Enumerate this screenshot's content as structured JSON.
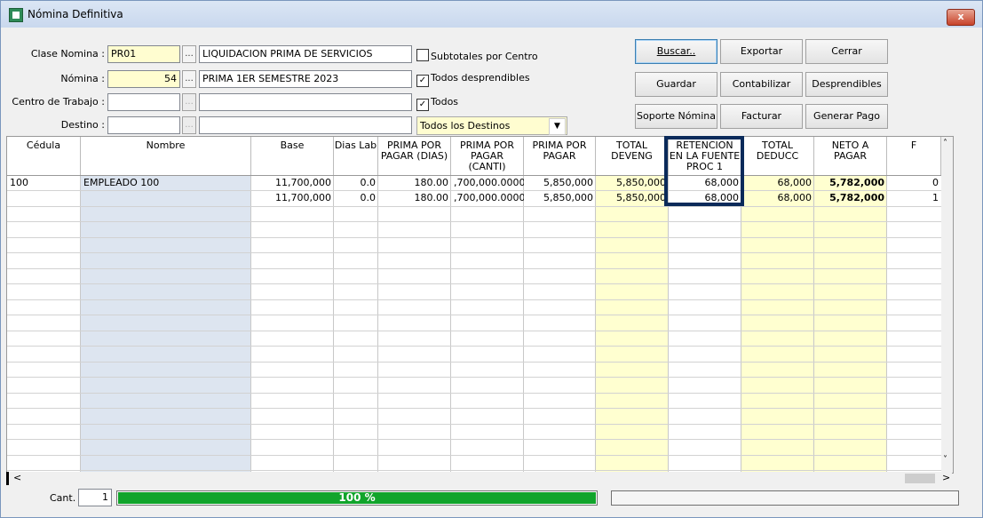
{
  "window": {
    "title": "Nómina Definitiva",
    "close_label": "x"
  },
  "form": {
    "clase_label": "Clase Nomina :",
    "clase_code": "PR01",
    "clase_desc": "LIQUIDACION PRIMA DE SERVICIOS",
    "nomina_label": "Nómina :",
    "nomina_code": "54",
    "nomina_desc": "PRIMA 1ER SEMESTRE 2023",
    "centro_label": "Centro de Trabajo :",
    "destino_label": "Destino :",
    "dots": "...",
    "chk_subtotales": "Subtotales por Centro",
    "chk_desprendibles": "Todos desprendibles",
    "chk_todos": "Todos",
    "destinos_value": "Todos los Destinos"
  },
  "buttons": {
    "buscar": "Buscar..",
    "exportar": "Exportar",
    "cerrar": "Cerrar",
    "guardar": "Guardar",
    "contabilizar": "Contabilizar",
    "desprendibles": "Desprendibles",
    "soporte": "Soporte Nómina",
    "facturar": "Facturar",
    "generar_pago": "Generar Pago"
  },
  "table": {
    "headers": [
      "Cédula",
      "Nombre",
      "Base",
      "Dias Lab",
      "PRIMA POR PAGAR (DIAS)",
      "PRIMA POR PAGAR (CANTI)",
      "PRIMA POR PAGAR",
      "TOTAL DEVENG",
      "RETENCION EN LA FUENTE PROC 1",
      "TOTAL DEDUCC",
      "NETO A PAGAR",
      "F"
    ],
    "rows": [
      [
        "100",
        "EMPLEADO 100",
        "11,700,000",
        "0.0",
        "180.00",
        ",700,000.0000",
        "5,850,000",
        "5,850,000",
        "68,000",
        "68,000",
        "5,782,000",
        "0"
      ],
      [
        "",
        "",
        "11,700,000",
        "0.0",
        "180.00",
        ",700,000.0000",
        "5,850,000",
        "5,850,000",
        "68,000",
        "68,000",
        "5,782,000",
        "1"
      ]
    ]
  },
  "footer": {
    "cant_label": "Cant.",
    "cant_value": "1",
    "progress_text": "100 %",
    "progress": 1.0
  },
  "colors": {
    "highlight_border": "#0a2a5a",
    "progress_fill": "#11a42b",
    "yellow_col": "#ffffd0",
    "blue_col": "#dde5f0"
  }
}
